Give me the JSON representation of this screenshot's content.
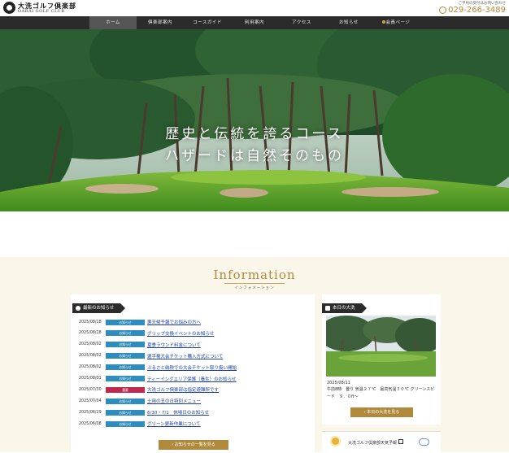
{
  "header": {
    "logo_jp": "大洗ゴルフ倶楽部",
    "logo_en": "OARAI GOLF CLUB",
    "contact_note": "ご予約の受付はお問い合わせ",
    "tel": "029-266-3489"
  },
  "nav": {
    "items": [
      "ホーム",
      "倶楽部案内",
      "コースガイド",
      "利用案内",
      "アクセス",
      "お知らせ",
      "会員ページ"
    ],
    "active": "ホーム"
  },
  "hero": {
    "line1": "歴史と伝統を誇るコース",
    "line2": "ハザードは自然そのもの"
  },
  "information": {
    "title": "Information",
    "subtitle": "インフォメーション",
    "news_tab": "最新のお知らせ",
    "news": [
      {
        "date": "2025/08/18",
        "tag": "お知らせ",
        "title": "悪天候予報でお悩みの方へ",
        "color": "blue"
      },
      {
        "date": "2025/08/18",
        "tag": "お知らせ",
        "title": "グリップ交換イベントのお知らせ",
        "color": "blue"
      },
      {
        "date": "2025/08/02",
        "tag": "お知らせ",
        "title": "夏季ラウンド料金について",
        "color": "blue"
      },
      {
        "date": "2025/08/02",
        "tag": "お知らせ",
        "title": "選手権大会チケット購入方式について",
        "color": "blue"
      },
      {
        "date": "2025/08/02",
        "tag": "お知らせ",
        "title": "ふるさと納税での大会チケット取り扱い開始",
        "color": "blue"
      },
      {
        "date": "2025/08/01",
        "tag": "お知らせ",
        "title": "ティーイングエリア保護（養生）のお知らせ",
        "color": "blue"
      },
      {
        "date": "2025/07/30",
        "tag": "重要",
        "title": "大洗ゴルフ倶楽部は指定避難所です",
        "color": "red"
      },
      {
        "date": "2025/07/04",
        "tag": "お知らせ",
        "title": "土用の丑の日特別メニュー",
        "color": "blue"
      },
      {
        "date": "2025/06/29",
        "tag": "お知らせ",
        "title": "6/30・7/1　休場日のお知らせ",
        "color": "blue"
      },
      {
        "date": "2025/06/08",
        "tag": "お知らせ",
        "title": "グリーン更新作業について",
        "color": "blue"
      }
    ],
    "news_button": "› お知らせの一覧を見る",
    "today_tab": "本日の大洗",
    "today_date": "2025/08/11",
    "today_text": "午前8時　曇り 気温２７℃　最高気温３０℃ グリーンスピード　９．０ft～",
    "today_button": "› 本日の大洗を見る",
    "weather_link": "大洗ゴルフ倶楽部天気予報"
  },
  "colors": {
    "gold": "#b08a3a",
    "nav_bg": "#2b2b2b",
    "tag_blue": "#2f8dbd",
    "tag_red": "#c0294f",
    "link": "#1a3fa0",
    "section_bg": "#fbf6ea"
  },
  "icons": {
    "logo": "logo-emblem-icon",
    "phone": "phone-icon",
    "key": "key-icon",
    "clock": "clock-icon",
    "camera": "camera-icon",
    "sun": "sun-icon",
    "cloud": "cloud-icon"
  }
}
